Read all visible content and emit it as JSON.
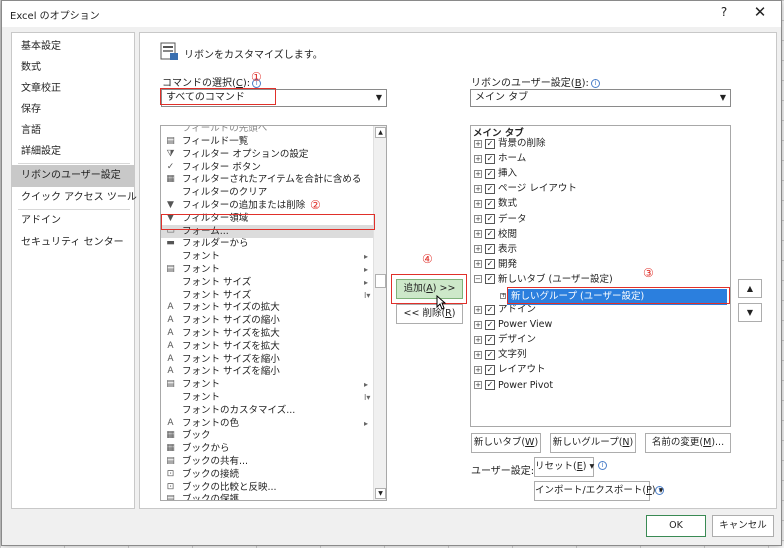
{
  "window": {
    "title": "Excel のオプション",
    "help": "?",
    "close": "✕"
  },
  "nav": {
    "items": [
      "基本設定",
      "数式",
      "文章校正",
      "保存",
      "言語",
      "詳細設定",
      "リボンのユーザー設定",
      "クイック アクセス ツール バー",
      "アドイン",
      "セキュリティ センター"
    ]
  },
  "header": {
    "title": "リボンをカスタマイズします。"
  },
  "commands": {
    "label_pre": "コマンドの選択(",
    "label_key": "C",
    "label_post": "):",
    "selected": "すべてのコマンド",
    "items": [
      {
        "text": "フィールド一覧",
        "icon": "▤"
      },
      {
        "text": "フィルター オプションの設定",
        "icon": "⧩"
      },
      {
        "text": "フィルター ボタン",
        "icon": "✓"
      },
      {
        "text": "フィルターされたアイテムを合計に含める",
        "icon": "▦"
      },
      {
        "text": "フィルターのクリア",
        "icon": ""
      },
      {
        "text": "フィルターの追加または削除",
        "icon": "▼"
      },
      {
        "text": "フィルター領域",
        "icon": "▼"
      },
      {
        "text": "フォーム...",
        "icon": "▭"
      },
      {
        "text": "フォルダーから",
        "icon": "▬"
      },
      {
        "text": "フォント",
        "icon": ""
      },
      {
        "text": "フォント",
        "icon": "▤"
      },
      {
        "text": "フォント サイズ",
        "icon": ""
      },
      {
        "text": "フォント サイズ",
        "icon": ""
      },
      {
        "text": "フォント サイズの拡大",
        "icon": "A"
      },
      {
        "text": "フォント サイズの縮小",
        "icon": "A"
      },
      {
        "text": "フォント サイズを拡大",
        "icon": "A"
      },
      {
        "text": "フォント サイズを拡大",
        "icon": "A"
      },
      {
        "text": "フォント サイズを縮小",
        "icon": "A"
      },
      {
        "text": "フォント サイズを縮小",
        "icon": "A"
      },
      {
        "text": "フォント",
        "icon": "▤"
      },
      {
        "text": "フォント",
        "icon": ""
      },
      {
        "text": "フォントのカスタマイズ...",
        "icon": ""
      },
      {
        "text": "フォントの色",
        "icon": "A"
      },
      {
        "text": "ブック",
        "icon": "▦"
      },
      {
        "text": "ブックから",
        "icon": "▦"
      },
      {
        "text": "ブックの共有...",
        "icon": "▤"
      },
      {
        "text": "ブックの接続",
        "icon": "⊡"
      },
      {
        "text": "ブックの比較と反映...",
        "icon": "⊡"
      },
      {
        "text": "ブックの保護",
        "icon": "▤"
      }
    ]
  },
  "markers": {
    "m1": "①",
    "m2": "②",
    "m3": "③",
    "m4": "④"
  },
  "middle": {
    "add_pre": "追加(",
    "add_key": "A",
    "add_post": ") >>",
    "remove_pre": "<< 削除(",
    "remove_key": "R",
    "remove_post": ")"
  },
  "ribbon": {
    "label_pre": "リボンのユーザー設定(",
    "label_key": "B",
    "label_post": "):",
    "selected": "メイン タブ",
    "tree_header": "メイン タブ",
    "tree": [
      {
        "text": "背景の削除",
        "indent": 0,
        "pm": "+"
      },
      {
        "text": "ホーム",
        "indent": 0,
        "pm": "+"
      },
      {
        "text": "挿入",
        "indent": 0,
        "pm": "+"
      },
      {
        "text": "ページ レイアウト",
        "indent": 0,
        "pm": "+"
      },
      {
        "text": "数式",
        "indent": 0,
        "pm": "+"
      },
      {
        "text": "データ",
        "indent": 0,
        "pm": "+"
      },
      {
        "text": "校閲",
        "indent": 0,
        "pm": "+"
      },
      {
        "text": "表示",
        "indent": 0,
        "pm": "+"
      },
      {
        "text": "開発",
        "indent": 0,
        "pm": "+"
      },
      {
        "text": "新しいタブ (ユーザー設定)",
        "indent": 0,
        "pm": "−"
      },
      {
        "text": "アドイン",
        "indent": 0,
        "pm": "+"
      },
      {
        "text": "Power View",
        "indent": 0,
        "pm": "+"
      },
      {
        "text": "デザイン",
        "indent": 0,
        "pm": "+"
      },
      {
        "text": "文字列",
        "indent": 0,
        "pm": "+"
      },
      {
        "text": "レイアウト",
        "indent": 0,
        "pm": "+"
      },
      {
        "text": "Power Pivot",
        "indent": 0,
        "pm": "+"
      }
    ],
    "selected_group": "新しいグループ (ユーザー設定)",
    "up": "▲",
    "down": "▼",
    "new_tab": "新しいタブ(",
    "new_tab_key": "W",
    "new_tab_post": ")",
    "new_group": "新しいグループ(",
    "new_group_key": "N",
    "new_group_post": ")",
    "rename": "名前の変更(",
    "rename_key": "M",
    "rename_post": ")...",
    "user_settings_label": "ユーザー設定:",
    "reset": "リセット(",
    "reset_key": "E",
    "reset_post": ") ▾",
    "import_export": "インポート/エクスポート(",
    "import_export_key": "P",
    "import_export_post": ") ▾"
  },
  "footer": {
    "ok": "OK",
    "cancel": "キャンセル"
  },
  "colors": {
    "accent_red": "#e0302a",
    "selection_blue": "#2b7fde",
    "add_button_green": "#cde8c9"
  }
}
